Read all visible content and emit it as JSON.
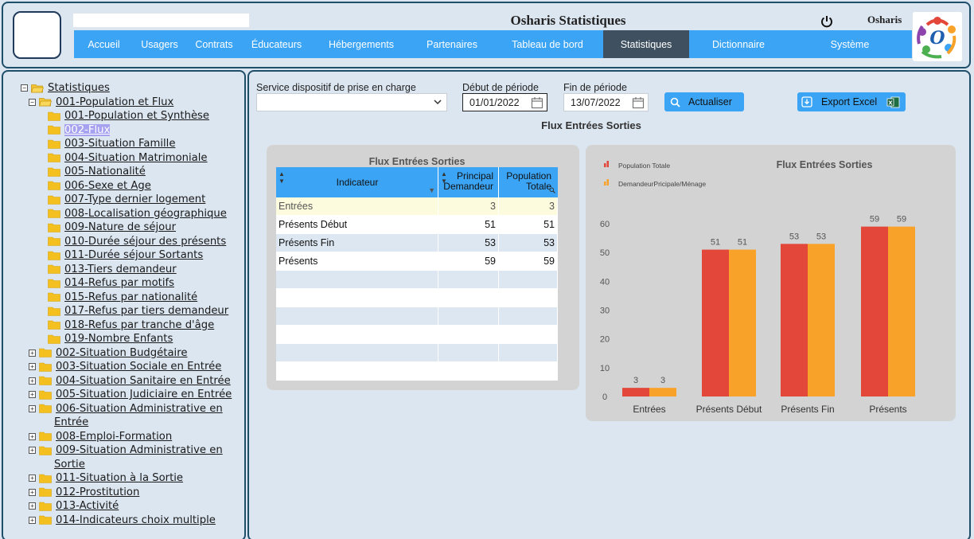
{
  "header": {
    "title": "Osharis Statistiques",
    "user": "Osharis",
    "logo_letter": "O",
    "nav": [
      {
        "label": "Accueil",
        "w": 75
      },
      {
        "label": "Usagers",
        "w": 65
      },
      {
        "label": "Contrats",
        "w": 72
      },
      {
        "label": "Éducateurs",
        "w": 85
      },
      {
        "label": "Hébergements",
        "w": 128
      },
      {
        "label": "Partenaires",
        "w": 100
      },
      {
        "label": "Tableau de bord",
        "w": 140
      },
      {
        "label": "Statistiques",
        "w": 108,
        "active": true
      },
      {
        "label": "Dictionnaire",
        "w": 124
      },
      {
        "label": "Système",
        "w": 156
      }
    ]
  },
  "tree": [
    {
      "label": "Statistiques",
      "level": 1,
      "pm": "-",
      "open": true
    },
    {
      "label": "001-Population et Flux",
      "level": 2,
      "pm": "-",
      "open": true
    },
    {
      "label": "001-Population et Synthèse",
      "level": 3
    },
    {
      "label": "002-Flux",
      "level": 3,
      "selected": true
    },
    {
      "label": "003-Situation Famille",
      "level": 3
    },
    {
      "label": "004-Situation Matrimoniale",
      "level": 3
    },
    {
      "label": "005-Nationalité",
      "level": 3
    },
    {
      "label": "006-Sexe et Age",
      "level": 3
    },
    {
      "label": "007-Type dernier logement",
      "level": 3
    },
    {
      "label": "008-Localisation géographique",
      "level": 3
    },
    {
      "label": "009-Nature de séjour",
      "level": 3
    },
    {
      "label": "010-Durée séjour des présents",
      "level": 3
    },
    {
      "label": "011-Durée séjour Sortants",
      "level": 3
    },
    {
      "label": "013-Tiers demandeur",
      "level": 3
    },
    {
      "label": "014-Refus par motifs",
      "level": 3
    },
    {
      "label": "015-Refus par nationalité",
      "level": 3
    },
    {
      "label": "017-Refus par tiers demandeur",
      "level": 3
    },
    {
      "label": "018-Refus par tranche d'âge",
      "level": 3
    },
    {
      "label": "019-Nombre Enfants",
      "level": 3
    },
    {
      "label": "002-Situation Budgétaire",
      "level": 2,
      "pm": "+"
    },
    {
      "label": "003-Situation Sociale en Entrée",
      "level": 2,
      "pm": "+"
    },
    {
      "label": "004-Situation Sanitaire en Entrée",
      "level": 2,
      "pm": "+"
    },
    {
      "label": "005-Situation Judiciaire en Entrée",
      "level": 2,
      "pm": "+"
    },
    {
      "label": "006-Situation Administrative en",
      "cont": "Entrée",
      "level": 2,
      "pm": "+"
    },
    {
      "label": "008-Emploi-Formation",
      "level": 2,
      "pm": "+"
    },
    {
      "label": "009-Situation Administrative en",
      "cont": "Sortie",
      "level": 2,
      "pm": "+"
    },
    {
      "label": "011-Situation à la Sortie",
      "level": 2,
      "pm": "+"
    },
    {
      "label": "012-Prostitution",
      "level": 2,
      "pm": "+"
    },
    {
      "label": "013-Activité",
      "level": 2,
      "pm": "+"
    },
    {
      "label": "014-Indicateurs choix multiple",
      "level": 2,
      "pm": "+"
    }
  ],
  "filters": {
    "service_label": "Service dispositif de prise en charge",
    "service_value": "",
    "start_label": "Début de période",
    "start_value": "01/01/2022",
    "end_label": "Fin de période",
    "end_value": "13/07/2022",
    "refresh_label": "Actualiser",
    "export_label": "Export Excel"
  },
  "section_title": "Flux Entrées Sorties",
  "table": {
    "title": "Flux Entrées Sorties",
    "headers": [
      "Indicateur",
      "Principal Demandeur",
      "Population Totale"
    ],
    "rows": [
      {
        "indicateur": "Entrées",
        "principal": "3",
        "population": "3"
      },
      {
        "indicateur": "Présents Début",
        "principal": "51",
        "population": "51"
      },
      {
        "indicateur": "Présents Fin",
        "principal": "53",
        "population": "53"
      },
      {
        "indicateur": "Présents",
        "principal": "59",
        "population": "59"
      }
    ],
    "empty_rows": 6
  },
  "chart_data": {
    "type": "bar",
    "title": "Flux Entrées Sorties",
    "categories": [
      "Entrées",
      "Présents Début",
      "Présents Fin",
      "Présents"
    ],
    "series": [
      {
        "name": "Population Totale",
        "color": "#e2473a",
        "values": [
          3,
          51,
          53,
          59
        ]
      },
      {
        "name": "DemandeurPricipale/Ménage",
        "color": "#f9a22a",
        "values": [
          3,
          51,
          53,
          59
        ]
      }
    ],
    "yticks": [
      0,
      10,
      20,
      30,
      40,
      50,
      60
    ],
    "ylim": [
      0,
      60
    ],
    "legend_position": "top-left"
  }
}
